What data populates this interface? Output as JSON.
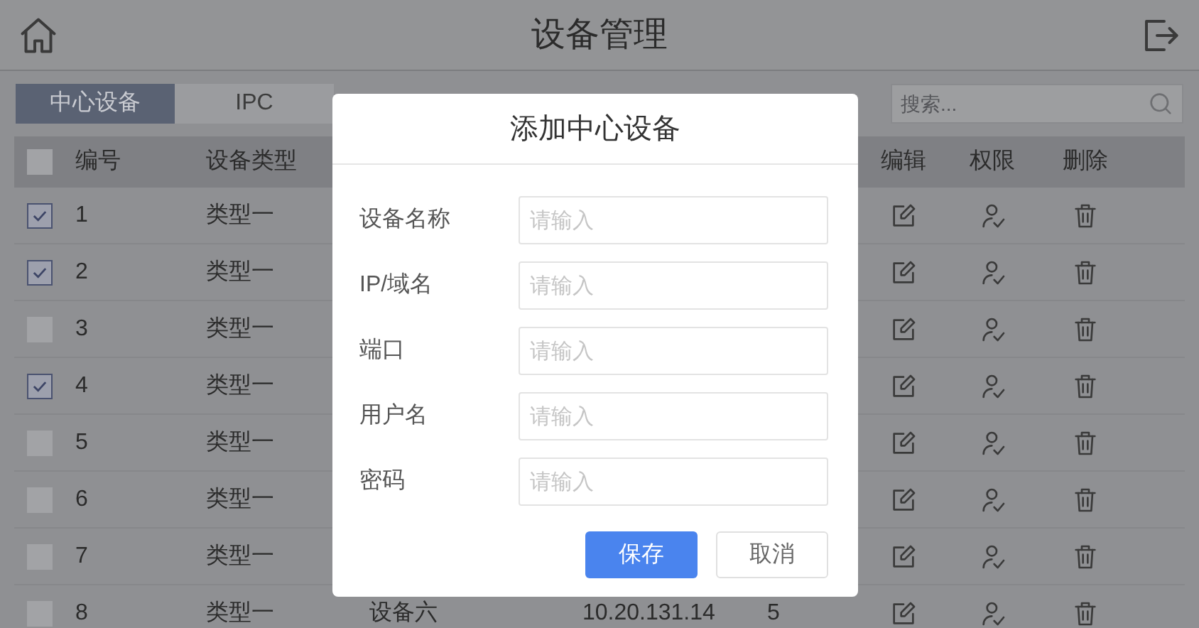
{
  "header": {
    "title": "设备管理"
  },
  "tabs": [
    {
      "label": "中心设备",
      "selected": true
    },
    {
      "label": "IPC",
      "selected": false
    }
  ],
  "search": {
    "placeholder": "搜索..."
  },
  "table": {
    "select_all": {
      "checked": false
    },
    "columns": [
      "编号",
      "设备类型",
      "编辑",
      "权限",
      "删除"
    ],
    "rows": [
      {
        "checked": true,
        "number": "1",
        "type": "类型一"
      },
      {
        "checked": true,
        "number": "2",
        "type": "类型一"
      },
      {
        "checked": false,
        "number": "3",
        "type": "类型一"
      },
      {
        "checked": true,
        "number": "4",
        "type": "类型一"
      },
      {
        "checked": false,
        "number": "5",
        "type": "类型一"
      },
      {
        "checked": false,
        "number": "6",
        "type": "类型一"
      },
      {
        "checked": false,
        "number": "7",
        "type": "类型一"
      },
      {
        "checked": false,
        "number": "8",
        "type": "类型一",
        "name": "设备六",
        "address": "10.20.131.14",
        "count": "5"
      }
    ]
  },
  "dialog": {
    "title": "添加中心设备",
    "fields": [
      {
        "label": "设备名称",
        "placeholder": "请输入"
      },
      {
        "label": "IP/域名",
        "placeholder": "请输入"
      },
      {
        "label": "端口",
        "placeholder": "请输入"
      },
      {
        "label": "用户名",
        "placeholder": "请输入"
      },
      {
        "label": "密码",
        "placeholder": "请输入"
      }
    ],
    "buttons": [
      {
        "label": "保存",
        "kind": "primary"
      },
      {
        "label": "取消",
        "kind": "secondary"
      }
    ]
  }
}
